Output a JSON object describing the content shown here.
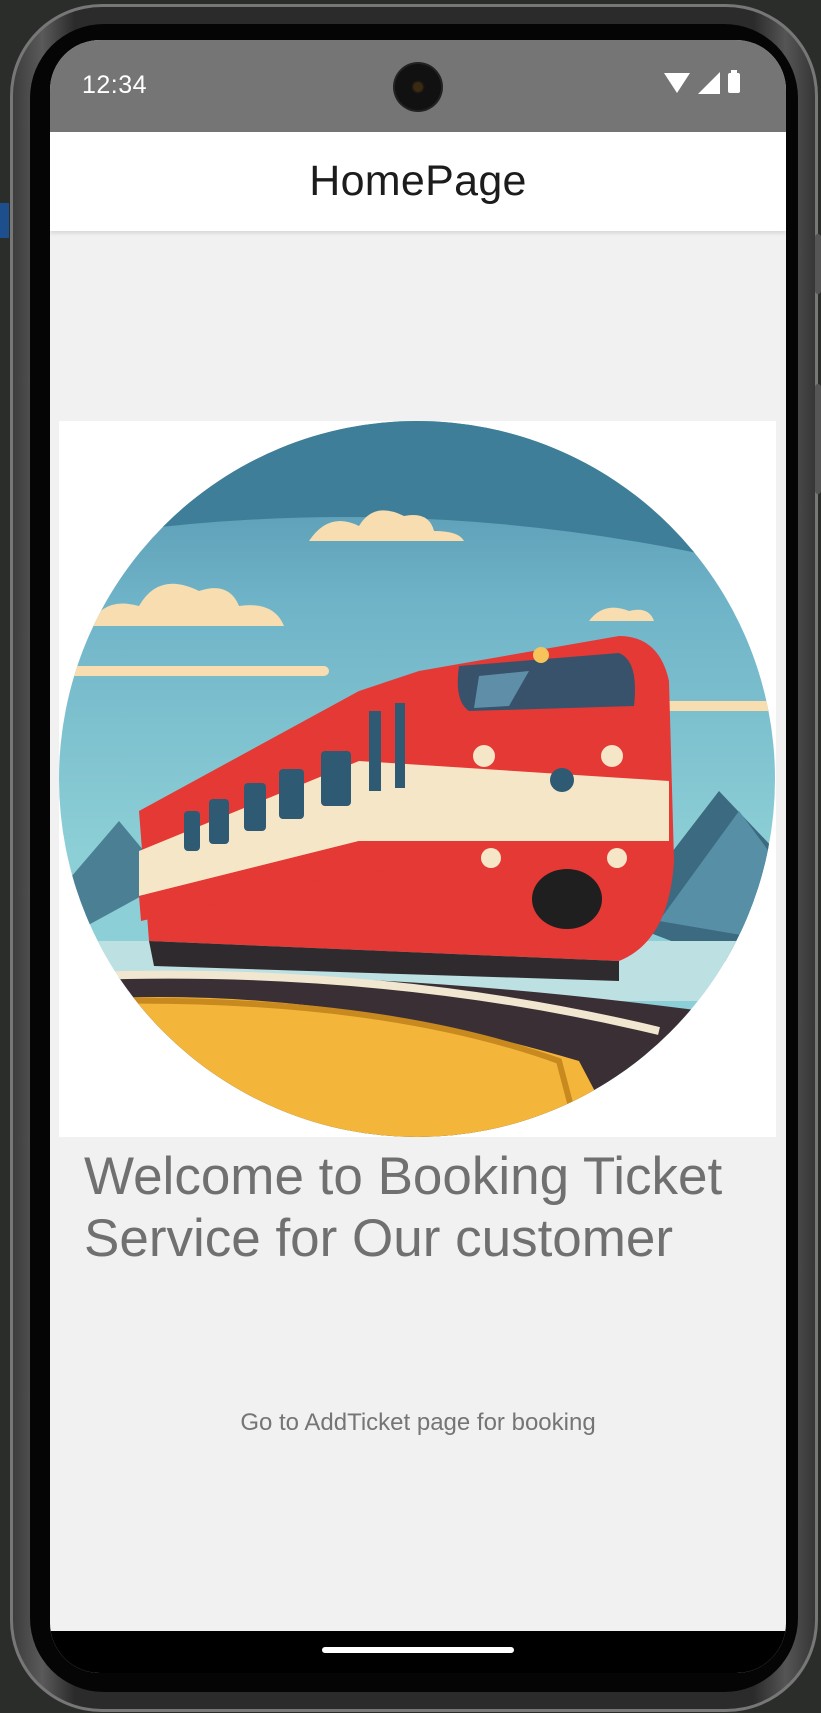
{
  "status_bar": {
    "time": "12:34"
  },
  "app_bar": {
    "title": "HomePage"
  },
  "main": {
    "welcome_text": "Welcome to Booking Ticket Service for Our customer",
    "navigate_text": "Go to AddTicket page for booking"
  },
  "colors": {
    "status_bar": "#757575",
    "background": "#f1f1f1",
    "text_gray": "#707070",
    "train_red": "#e53935"
  }
}
